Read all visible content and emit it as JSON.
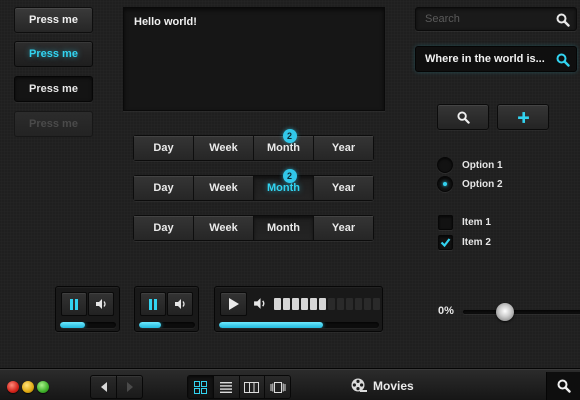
{
  "colors": {
    "accent": "#32d3f0",
    "background": "#1f1f1f"
  },
  "buttons": {
    "default_label": "Press me",
    "active_label": "Press me",
    "dark_label": "Press me",
    "disabled_label": "Press me"
  },
  "textarea": {
    "value": "Hello world!"
  },
  "segmented": [
    {
      "labels": [
        "Day",
        "Week",
        "Month",
        "Year"
      ],
      "selected": null,
      "badge": {
        "index": 2,
        "count": "2"
      }
    },
    {
      "labels": [
        "Day",
        "Week",
        "Month",
        "Year"
      ],
      "selected": "Month",
      "badge": {
        "index": 2,
        "count": "2"
      }
    },
    {
      "labels": [
        "Day",
        "Week",
        "Month",
        "Year"
      ],
      "selected": "Month",
      "badge": null
    }
  ],
  "search": {
    "placeholder": "Search",
    "active_value": "Where in the world is..."
  },
  "icon_buttons": [
    {
      "icon": "search-icon"
    },
    {
      "icon": "plus-icon"
    }
  ],
  "radios": [
    {
      "label": "Option 1",
      "checked": false
    },
    {
      "label": "Option 2",
      "checked": true
    }
  ],
  "checkboxes": [
    {
      "label": "Item 1",
      "checked": false
    },
    {
      "label": "Item 2",
      "checked": true
    }
  ],
  "players": [
    {
      "state": "paused",
      "progress": 0.45
    },
    {
      "state": "paused",
      "progress": 0.4
    },
    {
      "state": "stopped",
      "progress": 0.65,
      "volume_level": 6,
      "volume_max": 12
    }
  ],
  "slider": {
    "label": "0%",
    "value": 0.35
  },
  "toolbar": {
    "window_controls": [
      "close",
      "minimize",
      "zoom"
    ],
    "title": "Movies",
    "title_icon": "film-reel-icon",
    "view_modes": [
      "grid-icon",
      "list-icon",
      "columns-icon",
      "coverflow-icon"
    ],
    "selected_view": "grid-icon"
  }
}
